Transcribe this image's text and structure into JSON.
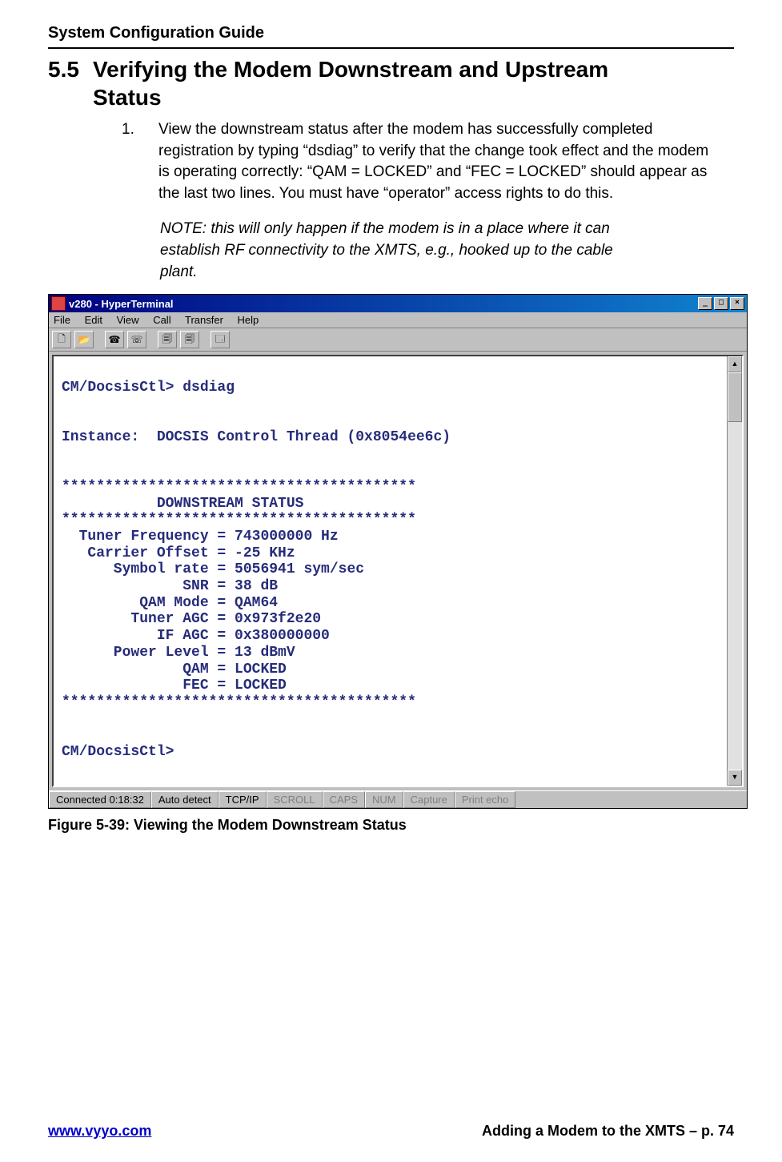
{
  "header": "System Configuration Guide",
  "section": {
    "num": "5.5",
    "title_line1": "Verifying the Modem Downstream and Upstream",
    "title_line2": "Status"
  },
  "step": {
    "num": "1.",
    "text": "View the downstream status after the modem has successfully completed registration by typing “dsdiag” to verify that the change took effect and the modem is operating correctly:  “QAM = LOCKED” and “FEC = LOCKED” should appear as the last two lines.  You must have “operator” access rights to do this."
  },
  "note": "NOTE:  this will only happen if the modem is in a place where it can establish RF connectivity to the XMTS, e.g., hooked up to the cable plant.",
  "window": {
    "title": "v280 - HyperTerminal",
    "menu": {
      "file": "File",
      "edit": "Edit",
      "view": "View",
      "call": "Call",
      "transfer": "Transfer",
      "help": "Help"
    }
  },
  "terminal_text": "\nCM/DocsisCtl> dsdiag\n\n\nInstance:  DOCSIS Control Thread (0x8054ee6c)\n\n\n*****************************************\n           DOWNSTREAM STATUS\n*****************************************\n  Tuner Frequency = 743000000 Hz\n   Carrier Offset = -25 KHz\n      Symbol rate = 5056941 sym/sec\n              SNR = 38 dB\n         QAM Mode = QAM64\n        Tuner AGC = 0x973f2e20\n           IF AGC = 0x380000000\n      Power Level = 13 dBmV\n              QAM = LOCKED\n              FEC = LOCKED\n*****************************************\n\n\nCM/DocsisCtl>",
  "status": {
    "conn": "Connected 0:18:32",
    "detect": "Auto detect",
    "proto": "TCP/IP",
    "scroll": "SCROLL",
    "caps": "CAPS",
    "num": "NUM",
    "capture": "Capture",
    "echo": "Print echo"
  },
  "figure_caption": "Figure 5-39: Viewing the Modem Downstream Status",
  "footer": {
    "url": "www.vyyo.com",
    "right": "Adding a Modem to the XMTS – p. 74"
  }
}
